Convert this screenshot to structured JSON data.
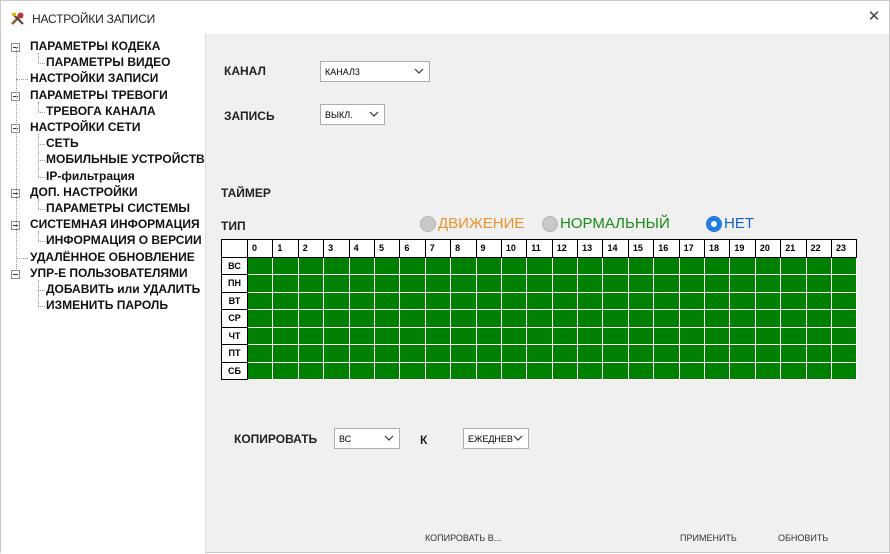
{
  "window": {
    "title": "НАСТРОЙКИ ЗАПИСИ",
    "close_symbol": "✕"
  },
  "tree": {
    "items": [
      {
        "label": "ПАРАМЕТРЫ КОДЕКА",
        "level": 0,
        "expanded": true
      },
      {
        "label": "ПАРАМЕТРЫ ВИДЕО",
        "level": 1
      },
      {
        "label": "НАСТРОЙКИ ЗАПИСИ",
        "level": 0
      },
      {
        "label": "ПАРАМЕТРЫ ТРЕВОГИ",
        "level": 0,
        "expanded": true
      },
      {
        "label": "ТРЕВОГА КАНАЛА",
        "level": 1
      },
      {
        "label": "НАСТРОЙКИ СЕТИ",
        "level": 0,
        "expanded": true
      },
      {
        "label": "СЕТЬ",
        "level": 1
      },
      {
        "label": "МОБИЛЬНЫЕ УСТРОЙСТВ",
        "level": 1
      },
      {
        "label": "IP-фильтрация",
        "level": 1
      },
      {
        "label": "ДОП. НАСТРОЙКИ",
        "level": 0,
        "expanded": true
      },
      {
        "label": "ПАРАМЕТРЫ СИСТЕМЫ",
        "level": 1
      },
      {
        "label": "СИСТЕМНАЯ ИНФОРМАЦИЯ",
        "level": 0,
        "expanded": true
      },
      {
        "label": "ИНФОРМАЦИЯ О ВЕРСИИ",
        "level": 1
      },
      {
        "label": "УДАЛЁННОЕ ОБНОВЛЕНИЕ",
        "level": 0
      },
      {
        "label": "УПР-Е ПОЛЬЗОВАТЕЛЯМИ",
        "level": 0,
        "expanded": true
      },
      {
        "label": "ДОБАВИТЬ или УДАЛИТЬ",
        "level": 1
      },
      {
        "label": "ИЗМЕНИТЬ ПАРОЛЬ",
        "level": 1
      }
    ]
  },
  "form": {
    "channel_label": "КАНАЛ",
    "channel_value": "КАНАЛ3",
    "record_label": "ЗАПИСЬ",
    "record_value": "ВЫКЛ.",
    "timer_label": "ТАЙМЕР",
    "type_label": "ТИП",
    "radios": [
      {
        "label": "ДВИЖЕНИЕ",
        "selected": false,
        "text_color": "#e8922c"
      },
      {
        "label": "НОРМАЛЬНЫЙ",
        "selected": false,
        "text_color": "#1a8a1a"
      },
      {
        "label": "НЕТ",
        "selected": true,
        "text_color": "#1565c0"
      }
    ],
    "copy_label": "КОПИРОВАТЬ",
    "copy_from_value": "ВС",
    "to_label": "К",
    "copy_to_value": "ЕЖЕДНЕВ"
  },
  "schedule": {
    "hours": [
      "0",
      "1",
      "2",
      "3",
      "4",
      "5",
      "6",
      "7",
      "8",
      "9",
      "10",
      "11",
      "12",
      "13",
      "14",
      "15",
      "16",
      "17",
      "18",
      "19",
      "20",
      "21",
      "22",
      "23"
    ],
    "days": [
      "ВС",
      "ПН",
      "ВТ",
      "СР",
      "ЧТ",
      "ПТ",
      "СБ"
    ],
    "fill_color": "#008000"
  },
  "buttons": {
    "copy_to": "КОПИРОВАТЬ В...",
    "apply": "ПРИМЕНИТЬ",
    "refresh": "ОБНОВИТЬ"
  },
  "icons": {
    "app": "tools-icon",
    "close": "close-icon",
    "dropdown": "chevron-down-icon"
  }
}
